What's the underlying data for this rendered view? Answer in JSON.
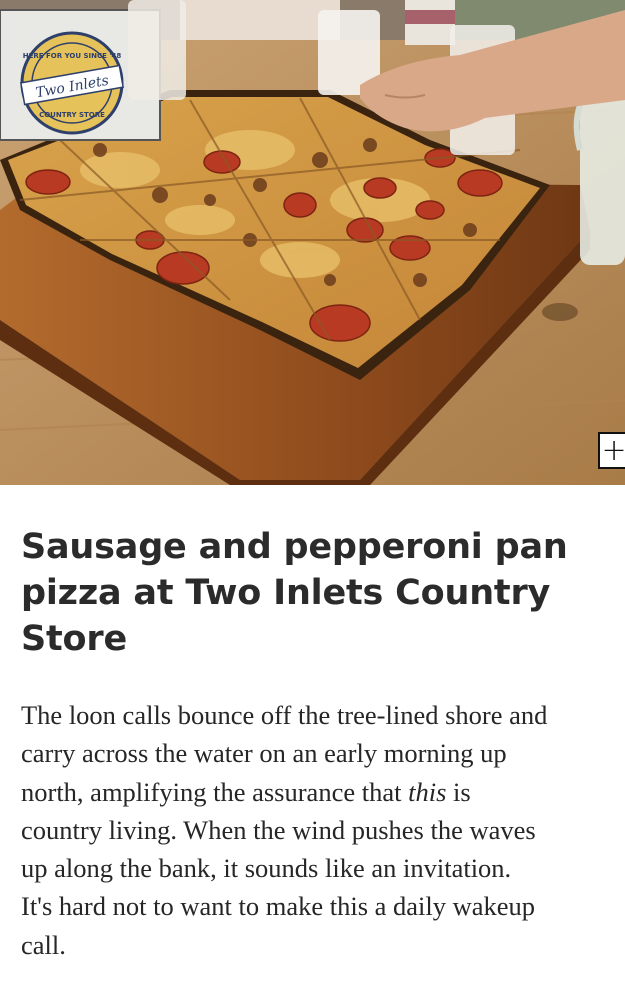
{
  "photo": {
    "sign_text_1": "HERE FOR YOU SINCE '48",
    "sign_text_2": "Two Inlets",
    "sign_text_3": "COUNTRY STORE"
  },
  "expand_button": {
    "symbol": "+"
  },
  "article": {
    "headline_lines": [
      "Sausage and pepperoni pan",
      "pizza at Two Inlets Country",
      "Store"
    ],
    "body": {
      "line1": "The loon calls bounce off the tree-lined shore and",
      "line2": "carry across the water on an early morning up",
      "line3_before": "north, amplifying the assurance that ",
      "line3_emph": "this",
      "line3_after": " is",
      "line4": "country living. When the wind pushes the waves",
      "line5": "up along the bank, it sounds like an invitation.",
      "line6": "It's hard not to want to make this a daily wakeup",
      "line7": "call."
    }
  }
}
